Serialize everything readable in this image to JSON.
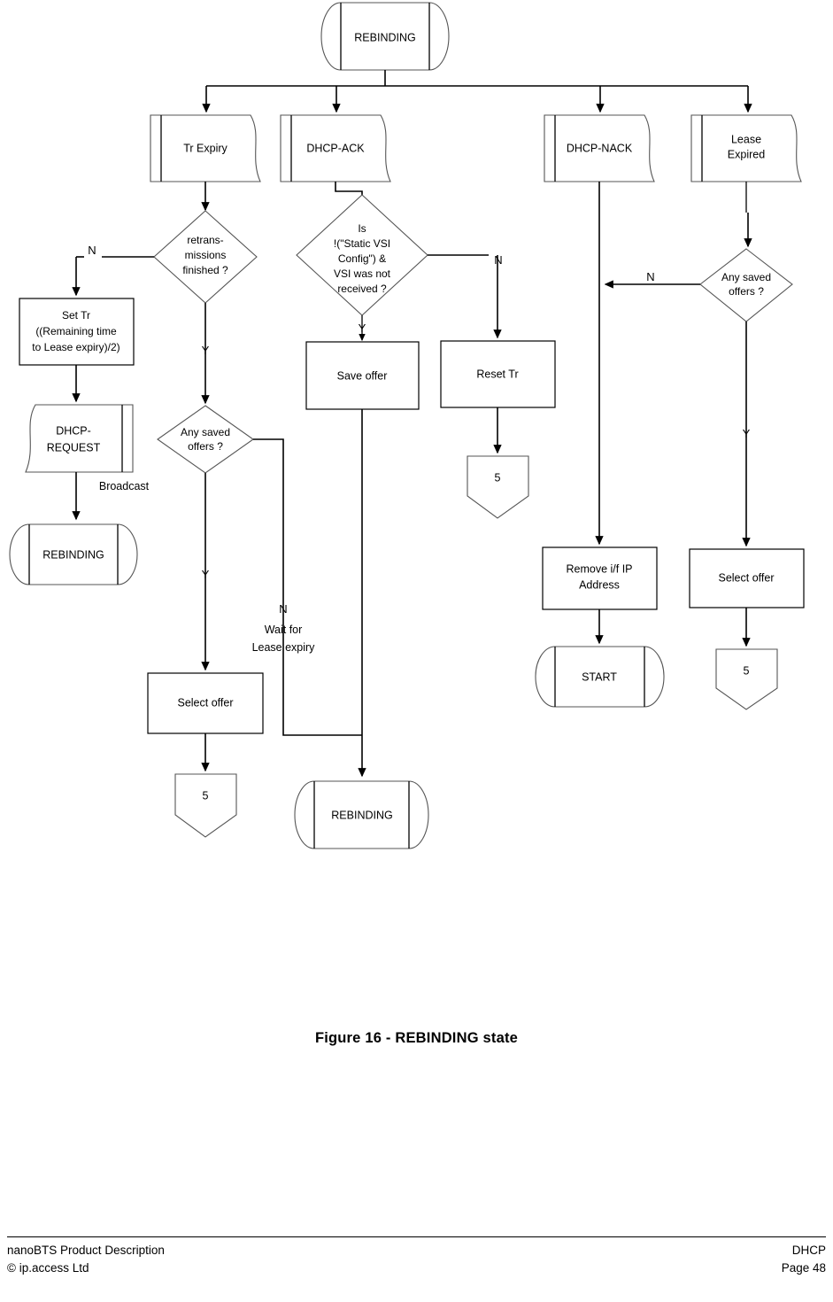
{
  "document": {
    "caption": "Figure 16 - REBINDING state",
    "footer": {
      "left_line1": "nanoBTS Product Description",
      "left_line2": "© ip.access Ltd",
      "right_line1": "DHCP",
      "right_line2": "Page 48"
    }
  },
  "flowchart": {
    "type": "state-diagram",
    "title": "REBINDING state",
    "nodes": {
      "start_state": {
        "label": "REBINDING",
        "shape": "state"
      },
      "event_tr_expiry": {
        "label": "Tr Expiry",
        "shape": "input-signal"
      },
      "event_dhcp_ack": {
        "label": "DHCP-ACK",
        "shape": "input-signal"
      },
      "event_dhcp_nack": {
        "label": "DHCP-NACK",
        "shape": "input-signal"
      },
      "event_lease_expired_l1": {
        "label": "Lease",
        "shape": "input-signal"
      },
      "event_lease_expired_l2": {
        "label": "Expired",
        "shape": "input-signal"
      },
      "dec_retrans_l1": {
        "label": "retrans-"
      },
      "dec_retrans_l2": {
        "label": "missions"
      },
      "dec_retrans_l3": {
        "label": "finished ?"
      },
      "dec_vsi_l1": {
        "label": "Is"
      },
      "dec_vsi_l2": {
        "label": "!(\"Static VSI"
      },
      "dec_vsi_l3": {
        "label": "Config\")   &"
      },
      "dec_vsi_l4": {
        "label": "VSI was not"
      },
      "dec_vsi_l5": {
        "label": "received ?"
      },
      "dec_saved_left_l1": {
        "label": "Any saved"
      },
      "dec_saved_left_l2": {
        "label": "offers ?"
      },
      "dec_saved_right_l1": {
        "label": "Any saved"
      },
      "dec_saved_right_l2": {
        "label": "offers ?"
      },
      "proc_set_tr_l1": {
        "label": "Set Tr"
      },
      "proc_set_tr_l2": {
        "label": "((Remaining time"
      },
      "proc_set_tr_l3": {
        "label": "to Lease expiry)/2)"
      },
      "out_dhcp_request_l1": {
        "label": "DHCP-"
      },
      "out_dhcp_request_l2": {
        "label": "REQUEST"
      },
      "state_rebinding_left": {
        "label": "REBINDING",
        "shape": "state"
      },
      "state_rebinding_bottom": {
        "label": "REBINDING",
        "shape": "state"
      },
      "proc_select_offer_left": {
        "label": "Select offer"
      },
      "proc_select_offer_right": {
        "label": "Select offer"
      },
      "proc_save_offer": {
        "label": "Save offer"
      },
      "proc_reset_tr": {
        "label": "Reset Tr"
      },
      "proc_remove_ip_l1": {
        "label": "Remove i/f IP"
      },
      "proc_remove_ip_l2": {
        "label": "Address"
      },
      "state_start": {
        "label": "START",
        "shape": "state"
      },
      "conn_five_mid": {
        "label": "5",
        "shape": "offpage-connector"
      },
      "conn_five_left": {
        "label": "5",
        "shape": "offpage-connector"
      },
      "conn_five_right": {
        "label": "5",
        "shape": "offpage-connector"
      }
    },
    "edge_labels": {
      "retrans_no": "N",
      "retrans_yes": "Y",
      "vsi_yes": "Y",
      "vsi_no": "N",
      "saved_left_yes": "Y",
      "saved_left_no": "N",
      "saved_left_no_note_l1": "Wait for",
      "saved_left_no_note_l2": "Lease expiry",
      "saved_right_no": "N",
      "saved_right_yes": "Y",
      "broadcast": "Broadcast"
    },
    "colors": {
      "stroke": "#000000",
      "shape_fill": "#ffffff",
      "light_stroke": "#555555"
    }
  }
}
